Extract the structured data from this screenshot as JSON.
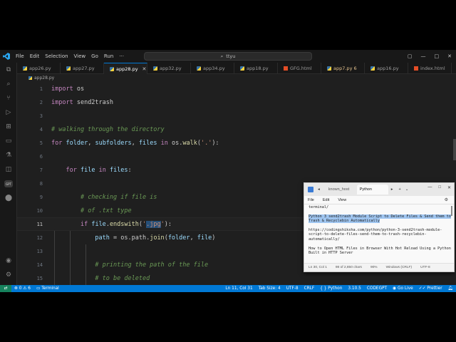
{
  "titlebar": {
    "menu": [
      "File",
      "Edit",
      "Selection",
      "View",
      "Go",
      "Run"
    ],
    "search": "ttyu"
  },
  "tabs": [
    {
      "label": "app26.py",
      "type": "py",
      "active": false
    },
    {
      "label": "app27.py",
      "type": "py",
      "active": false
    },
    {
      "label": "app28.py",
      "type": "py",
      "active": true
    },
    {
      "label": "app32.py",
      "type": "py",
      "active": false
    },
    {
      "label": "app34.py",
      "type": "py",
      "active": false
    },
    {
      "label": "app18.py",
      "type": "py",
      "active": false
    },
    {
      "label": "GFG.html",
      "type": "html",
      "active": false
    },
    {
      "label": "app7.py 6",
      "type": "py",
      "active": false,
      "modified": true
    },
    {
      "label": "app16.py",
      "type": "py",
      "active": false
    },
    {
      "label": "index.html",
      "type": "html",
      "active": false
    }
  ],
  "breadcrumb": "app28.py",
  "editor": {
    "line_numbers": [
      "1",
      "2",
      "3",
      "4",
      "5",
      "6",
      "7",
      "8",
      "9",
      "10",
      "11",
      "12",
      "13",
      "14",
      "15"
    ],
    "current_line": "11"
  },
  "statusbar": {
    "problems": "⊗ 0 ⚠ 6",
    "terminal": "Terminal",
    "position": "Ln 11, Col 31",
    "tab_size": "Tab Size: 4",
    "encoding": "UTF-8",
    "eol": "CRLF",
    "language": "Python",
    "version": "3.10.5",
    "codegpt": "CODEGPT",
    "go_live": "Go Live",
    "prettier": "Prettier"
  },
  "notepad": {
    "tabs": [
      "known_host",
      "Python"
    ],
    "menu": [
      "File",
      "Edit",
      "View"
    ],
    "lines": [
      "terminal/",
      "Python 3 send2trash Module Script to Delete Files & Send them to Trash & Recyclebin Automatically",
      "https://codingshiksha.com/python/python-3-send2trash-module-script-to-delete-files-send-them-to-trash-recyclebin-automatically/",
      "How to Open HTML Files in Browser With Hot Reload Using a Python Built in HTTP Server"
    ],
    "status": {
      "position": "Ln 30, Col 1",
      "chars": "98 of 2,850 chars",
      "zoom": "90%",
      "eol": "Windows (CRLF)",
      "encoding": "UTF-8"
    }
  },
  "colors": {
    "accent": "#0078d4",
    "keyword": "#c586c0",
    "comment": "#6a9955",
    "string": "#ce9178"
  }
}
